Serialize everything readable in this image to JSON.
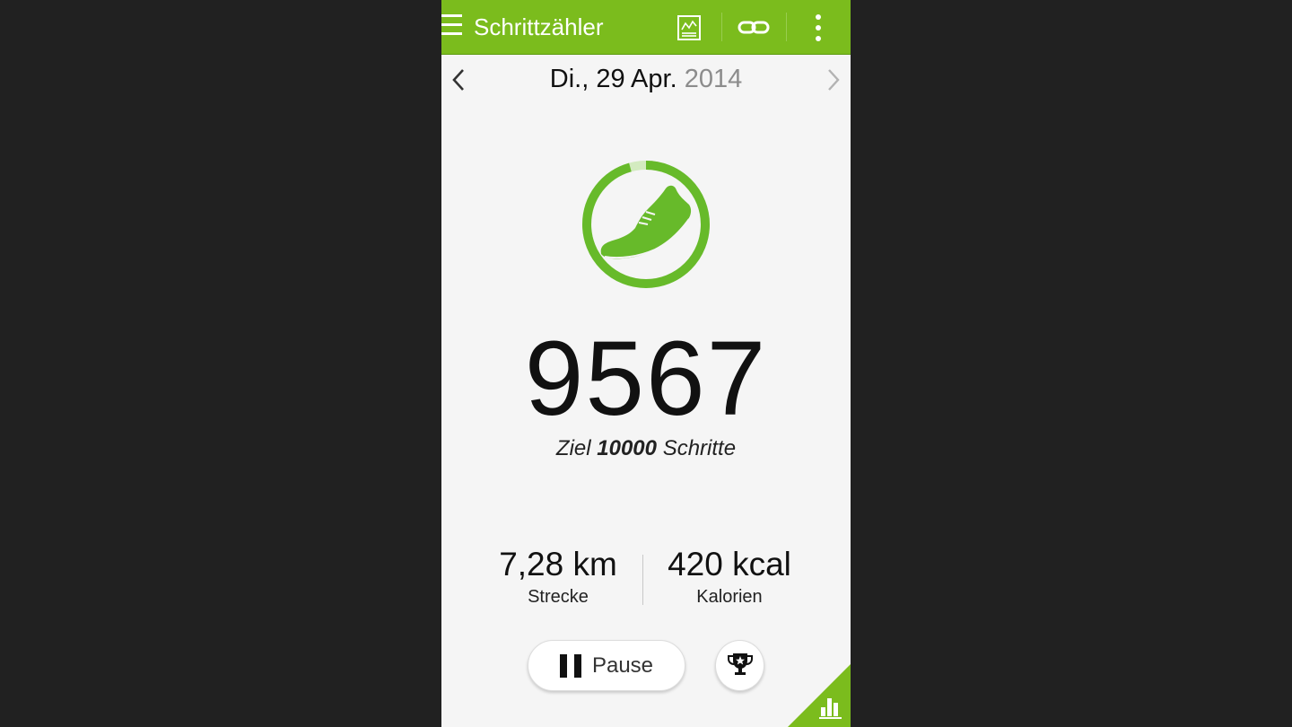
{
  "app": {
    "title": "Schrittzähler"
  },
  "toolbar": {
    "icons": [
      "menu-icon",
      "trend-chart-icon",
      "link-icon",
      "overflow-menu-icon"
    ]
  },
  "date": {
    "day": "Di., 29 Apr.",
    "year": "2014"
  },
  "progress": {
    "steps": 9567,
    "goal": 10000,
    "fraction": 0.9567
  },
  "steps": {
    "count": "9567",
    "goal_prefix": "Ziel",
    "goal_value": "10000",
    "goal_suffix": "Schritte"
  },
  "stats": {
    "distance_value": "7,28 km",
    "distance_label": "Strecke",
    "calories_value": "420 kcal",
    "calories_label": "Kalorien"
  },
  "controls": {
    "pause_label": "Pause"
  },
  "colors": {
    "accent": "#7bbc1d",
    "ring": "#67ba2a",
    "ring_track": "#d3ebc0",
    "background": "#f5f5f5"
  }
}
